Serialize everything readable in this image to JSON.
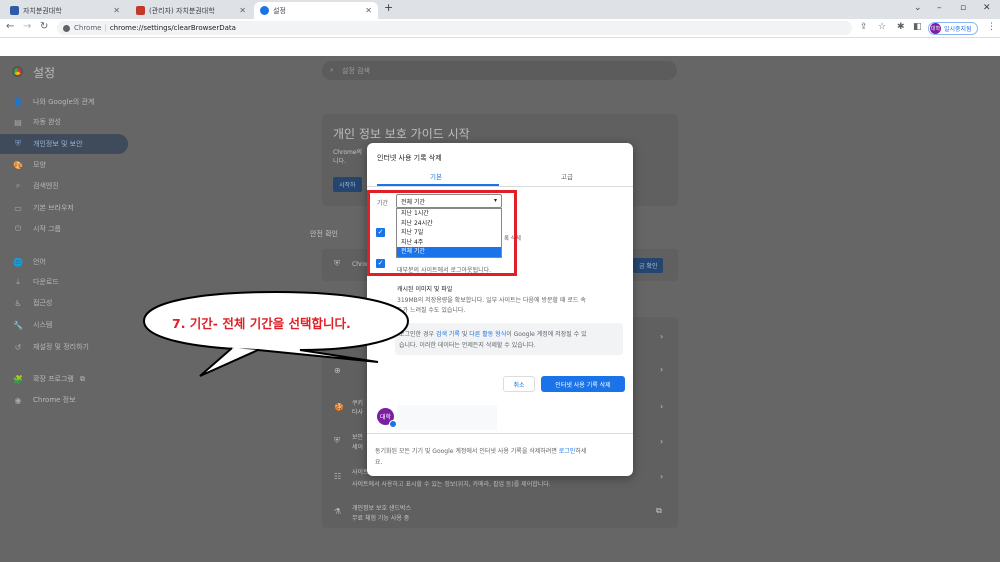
{
  "tabs": [
    {
      "title": "자치분권대학",
      "color": "#2e5aa7"
    },
    {
      "title": "(관리자) 자치분권대학",
      "color": "#c0392b"
    },
    {
      "title": "설정",
      "color": "#1a73e8"
    }
  ],
  "toolbar": {
    "chrome_label": "Chrome",
    "url": "chrome://settings/clearBrowserData",
    "profile_avatar": "대학",
    "profile_label": "일시중지됨"
  },
  "settings": {
    "title": "설정",
    "search_placeholder": "설정 검색",
    "sidebar": [
      {
        "label": "나와 Google의 관계",
        "icon": "person-icon",
        "glyph": "👤"
      },
      {
        "label": "자동 완성",
        "icon": "autofill-icon",
        "glyph": "▤"
      },
      {
        "label": "개인정보 및 보안",
        "icon": "shield-icon",
        "glyph": "⛨",
        "active": true
      },
      {
        "label": "모양",
        "icon": "palette-icon",
        "glyph": "🎨"
      },
      {
        "label": "검색엔진",
        "icon": "search-icon",
        "glyph": "⌕"
      },
      {
        "label": "기본 브라우저",
        "icon": "browser-icon",
        "glyph": "▭"
      },
      {
        "label": "시작 그룹",
        "icon": "power-icon",
        "glyph": "⏻"
      },
      {
        "label": "언어",
        "icon": "globe-icon",
        "glyph": "🌐"
      },
      {
        "label": "다운로드",
        "icon": "download-icon",
        "glyph": "⤓"
      },
      {
        "label": "접근성",
        "icon": "accessibility-icon",
        "glyph": "♿"
      },
      {
        "label": "시스템",
        "icon": "wrench-icon",
        "glyph": "🔧"
      },
      {
        "label": "재설정 및 정리하기",
        "icon": "reset-icon",
        "glyph": "↺"
      },
      {
        "label": "확장 프로그램",
        "icon": "puzzle-icon",
        "glyph": "🧩"
      },
      {
        "label": "Chrome 정보",
        "icon": "chrome-icon",
        "glyph": "◉"
      }
    ],
    "guide_title": "개인 정보 보호 가이드 시작",
    "guide_desc": "Chrome의",
    "guide_desc2": "니다.",
    "guide_button": "시작하",
    "safety_header": "안전 확인",
    "safety_item": "Chrome",
    "safety_button": "금 확인",
    "section_items": [
      "쿠키",
      "보안",
      "사이트 설정",
      "개인정보 보호 샌드박스"
    ],
    "section_sub": [
      "타사",
      "세이",
      "사이트에서 사용하고 표시할 수 있는 정보(위치, 카메라, 팝업 등)를 제어합니다.",
      "무료 체험 기능 사용 중"
    ]
  },
  "dialog": {
    "title": "인터넷 사용 기록 삭제",
    "tab_basic": "기본",
    "tab_advanced": "고급",
    "range_label": "기간",
    "range_selected": "전체 기간",
    "range_options": [
      "지난 1시간",
      "지난 24시간",
      "지난 7일",
      "지난 4주",
      "전체 기간"
    ],
    "range_selected_index": 4,
    "history_suffix": "록 삭제",
    "cookies_sub": "대부분의 사이트에서 로그아웃됩니다.",
    "cache_title": "캐시된 이미지 및 파일",
    "cache_sub1": "319MB의 저장용량을 확보합니다. 일부 사이트는 다음에 방문할 때 로드 속",
    "cache_sub2": "도가 느려질 수도 있습니다.",
    "info_prefix": "로그인한 경우 ",
    "info_link1": "검색 기록",
    "info_mid": " 및 ",
    "info_link2": "다른 활동 형식",
    "info_suffix": "이 Google 계정에 저장될 수 있",
    "info_line2": "습니다. 이러한 데이터는 언제든지 삭제할 수 있습니다.",
    "cancel": "취소",
    "delete": "인터넷 사용 기록 삭제",
    "account_avatar": "대학",
    "footer_prefix": "동기화된 모든 기기 및 Google 계정에서 인터넷 사용 기록을 삭제하려면 ",
    "footer_link": "로그인",
    "footer_suffix": "하세",
    "footer_line2": "요."
  },
  "callout": {
    "text": "7. 기간- 전체 기간을 선택합니다."
  },
  "colors": {
    "accent": "#1a73e8",
    "highlight": "#e01f26"
  }
}
